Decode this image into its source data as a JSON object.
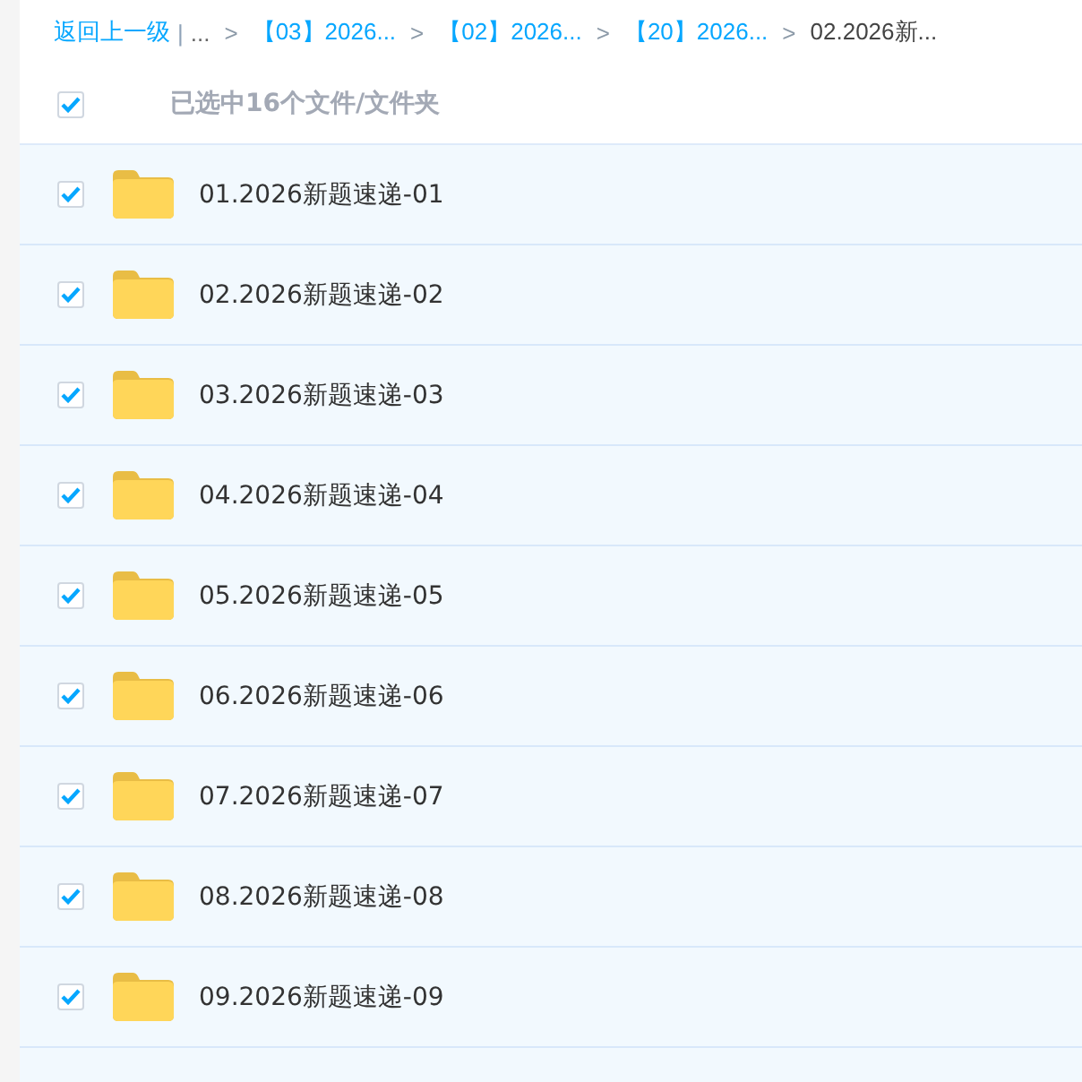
{
  "breadcrumb": {
    "back": "返回上一级",
    "separator": "|",
    "ellipsis": "...",
    "arrow": ">",
    "items": [
      {
        "label": "【03】2026...",
        "current": false
      },
      {
        "label": "【02】2026...",
        "current": false
      },
      {
        "label": "【20】2026...",
        "current": false
      },
      {
        "label": "02.2026新...",
        "current": true
      }
    ]
  },
  "selection": {
    "checked": true,
    "label": "已选中16个文件/文件夹"
  },
  "files": [
    {
      "name": "01.2026新题速递-01",
      "checked": true
    },
    {
      "name": "02.2026新题速递-02",
      "checked": true
    },
    {
      "name": "03.2026新题速递-03",
      "checked": true
    },
    {
      "name": "04.2026新题速递-04",
      "checked": true
    },
    {
      "name": "05.2026新题速递-05",
      "checked": true
    },
    {
      "name": "06.2026新题速递-06",
      "checked": true
    },
    {
      "name": "07.2026新题速递-07",
      "checked": true
    },
    {
      "name": "08.2026新题速递-08",
      "checked": true
    },
    {
      "name": "09.2026新题速递-09",
      "checked": true
    }
  ]
}
